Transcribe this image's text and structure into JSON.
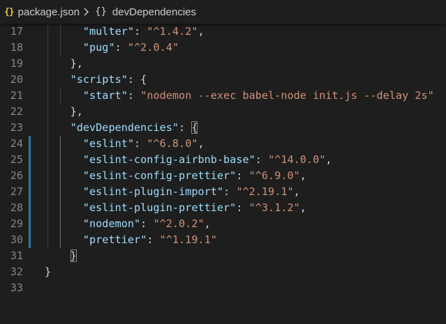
{
  "breadcrumb": {
    "json_icon": "{}",
    "file": "package.json",
    "chevron": "chevron-right-icon",
    "symbol_icon": "{}",
    "symbol": "devDependencies"
  },
  "colors": {
    "background": "#1e1e1e",
    "key": "#9cdcfe",
    "string": "#ce9178",
    "punctuation": "#d4d4d4",
    "line_number": "#858585",
    "git_modified": "#1b81a8",
    "json_icon": "#e8c53f"
  },
  "lines": [
    {
      "n": "17",
      "indent": "      ",
      "tokens": [
        {
          "t": "k",
          "v": "\"multer\""
        },
        {
          "t": "p",
          "v": ": "
        },
        {
          "t": "s",
          "v": "\"^1.4.2\""
        },
        {
          "t": "p",
          "v": ","
        }
      ]
    },
    {
      "n": "18",
      "indent": "      ",
      "tokens": [
        {
          "t": "k",
          "v": "\"pug\""
        },
        {
          "t": "p",
          "v": ": "
        },
        {
          "t": "s",
          "v": "\"^2.0.4\""
        }
      ]
    },
    {
      "n": "19",
      "indent": "    ",
      "tokens": [
        {
          "t": "p",
          "v": "},"
        }
      ]
    },
    {
      "n": "20",
      "indent": "    ",
      "tokens": [
        {
          "t": "k",
          "v": "\"scripts\""
        },
        {
          "t": "p",
          "v": ": {"
        }
      ]
    },
    {
      "n": "21",
      "indent": "      ",
      "tokens": [
        {
          "t": "k",
          "v": "\"start\""
        },
        {
          "t": "p",
          "v": ": "
        },
        {
          "t": "s",
          "v": "\"nodemon --exec babel-node init.js --delay 2s\""
        }
      ]
    },
    {
      "n": "22",
      "indent": "    ",
      "tokens": [
        {
          "t": "p",
          "v": "},"
        }
      ]
    },
    {
      "n": "23",
      "indent": "    ",
      "tokens": [
        {
          "t": "k",
          "v": "\"devDependencies\""
        },
        {
          "t": "p",
          "v": ": "
        },
        {
          "t": "p",
          "v": "{",
          "box": true
        }
      ]
    },
    {
      "n": "24",
      "indent": "      ",
      "tokens": [
        {
          "t": "k",
          "v": "\"eslint\""
        },
        {
          "t": "p",
          "v": ": "
        },
        {
          "t": "s",
          "v": "\"^6.8.0\""
        },
        {
          "t": "p",
          "v": ","
        }
      ]
    },
    {
      "n": "25",
      "indent": "      ",
      "tokens": [
        {
          "t": "k",
          "v": "\"eslint-config-airbnb-base\""
        },
        {
          "t": "p",
          "v": ": "
        },
        {
          "t": "s",
          "v": "\"^14.0.0\""
        },
        {
          "t": "p",
          "v": ","
        }
      ]
    },
    {
      "n": "26",
      "indent": "      ",
      "tokens": [
        {
          "t": "k",
          "v": "\"eslint-config-prettier\""
        },
        {
          "t": "p",
          "v": ": "
        },
        {
          "t": "s",
          "v": "\"^6.9.0\""
        },
        {
          "t": "p",
          "v": ","
        }
      ]
    },
    {
      "n": "27",
      "indent": "      ",
      "tokens": [
        {
          "t": "k",
          "v": "\"eslint-plugin-import\""
        },
        {
          "t": "p",
          "v": ": "
        },
        {
          "t": "s",
          "v": "\"^2.19.1\""
        },
        {
          "t": "p",
          "v": ","
        }
      ]
    },
    {
      "n": "28",
      "indent": "      ",
      "tokens": [
        {
          "t": "k",
          "v": "\"eslint-plugin-prettier\""
        },
        {
          "t": "p",
          "v": ": "
        },
        {
          "t": "s",
          "v": "\"^3.1.2\""
        },
        {
          "t": "p",
          "v": ","
        }
      ]
    },
    {
      "n": "29",
      "indent": "      ",
      "tokens": [
        {
          "t": "k",
          "v": "\"nodemon\""
        },
        {
          "t": "p",
          "v": ": "
        },
        {
          "t": "s",
          "v": "\"^2.0.2\""
        },
        {
          "t": "p",
          "v": ","
        }
      ]
    },
    {
      "n": "30",
      "indent": "      ",
      "tokens": [
        {
          "t": "k",
          "v": "\"prettier\""
        },
        {
          "t": "p",
          "v": ": "
        },
        {
          "t": "s",
          "v": "\"^1.19.1\""
        }
      ]
    },
    {
      "n": "31",
      "indent": "    ",
      "tokens": [
        {
          "t": "p",
          "v": "}",
          "box": true
        }
      ]
    },
    {
      "n": "32",
      "indent": "",
      "tokens": [
        {
          "t": "p",
          "v": "}"
        }
      ]
    },
    {
      "n": "33",
      "indent": "",
      "tokens": []
    }
  ]
}
